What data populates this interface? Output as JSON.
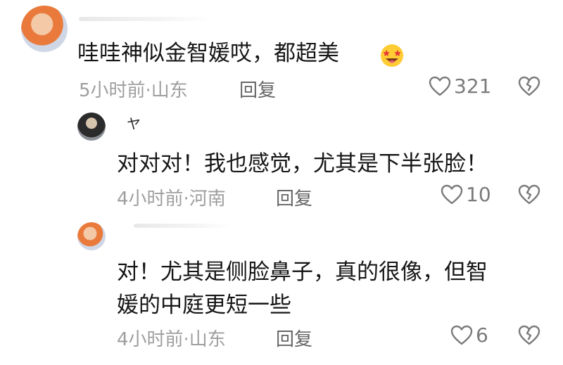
{
  "comments": [
    {
      "author": "",
      "text": "哇哇神似金智媛哎，都超美",
      "emoji": "star-struck-emoji",
      "time_location": "5小时前·山东",
      "reply_label": "回复",
      "likes": "321",
      "icons": {
        "like": "heart-outline-icon",
        "dislike": "broken-heart-icon"
      }
    },
    {
      "author": "ヤ",
      "text": "对对对！我也感觉，尤其是下半张脸！",
      "time_location": "4小时前·河南",
      "reply_label": "回复",
      "likes": "10",
      "icons": {
        "like": "heart-outline-icon",
        "dislike": "broken-heart-icon"
      }
    },
    {
      "author": "",
      "text_lines": [
        "对！尤其是侧脸鼻子，真的很像，但智",
        "媛的中庭更短一些"
      ],
      "time_location": "4小时前·山东",
      "reply_label": "回复",
      "likes": "6",
      "icons": {
        "like": "heart-outline-icon",
        "dislike": "broken-heart-icon"
      }
    }
  ]
}
